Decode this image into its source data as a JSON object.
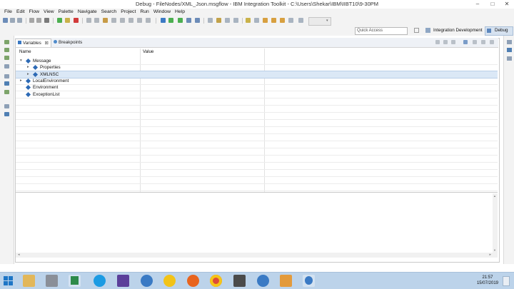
{
  "window": {
    "title": "Debug - FileNodes/XML_Json.msgflow - IBM Integration Toolkit - C:\\Users\\Shekar\\IBM\\IIBT10\\9-30PM",
    "minimize": "–",
    "maximize": "□",
    "close": "✕"
  },
  "menu": [
    "File",
    "Edit",
    "Flow",
    "View",
    "Palette",
    "Navigate",
    "Search",
    "Project",
    "Run",
    "Window",
    "Help"
  ],
  "quick_access": {
    "placeholder": "Quick Access"
  },
  "perspectives": [
    {
      "label": "Integration Development",
      "active": false
    },
    {
      "label": "Debug",
      "active": true
    }
  ],
  "view_tabs": [
    {
      "label": "Variables",
      "active": true,
      "close": "⊠"
    },
    {
      "label": "Breakpoints",
      "active": false
    }
  ],
  "table": {
    "columns": [
      "Name",
      "Value"
    ],
    "rows": [
      {
        "label": "Message",
        "expander": "▾",
        "level": 0,
        "selected": false
      },
      {
        "label": "Properties",
        "expander": "▸",
        "level": 1,
        "selected": false
      },
      {
        "label": "XMLNSC",
        "expander": "▸",
        "level": 1,
        "selected": true
      },
      {
        "label": "LocalEnvironment",
        "expander": "▸",
        "level": 0,
        "selected": false
      },
      {
        "label": "Environment",
        "expander": "",
        "level": 0,
        "selected": false
      },
      {
        "label": "ExceptionList",
        "expander": "",
        "level": 0,
        "selected": false
      }
    ]
  },
  "taskbar": {
    "items": [
      "windows-start",
      "file-explorer",
      "settings-app",
      "excel-app",
      "skype-app",
      "eclipse-app",
      "network-app",
      "norton-app",
      "firefox-app",
      "chrome-app",
      "media-app",
      "globe-app",
      "package-app",
      "ibm-toolkit-app"
    ],
    "time": "21:57",
    "date": "15/07/2019"
  },
  "colors": {
    "accent": "#2d6ab5",
    "selection": "#dbe8f6",
    "taskbar": "#bcd3ea"
  }
}
